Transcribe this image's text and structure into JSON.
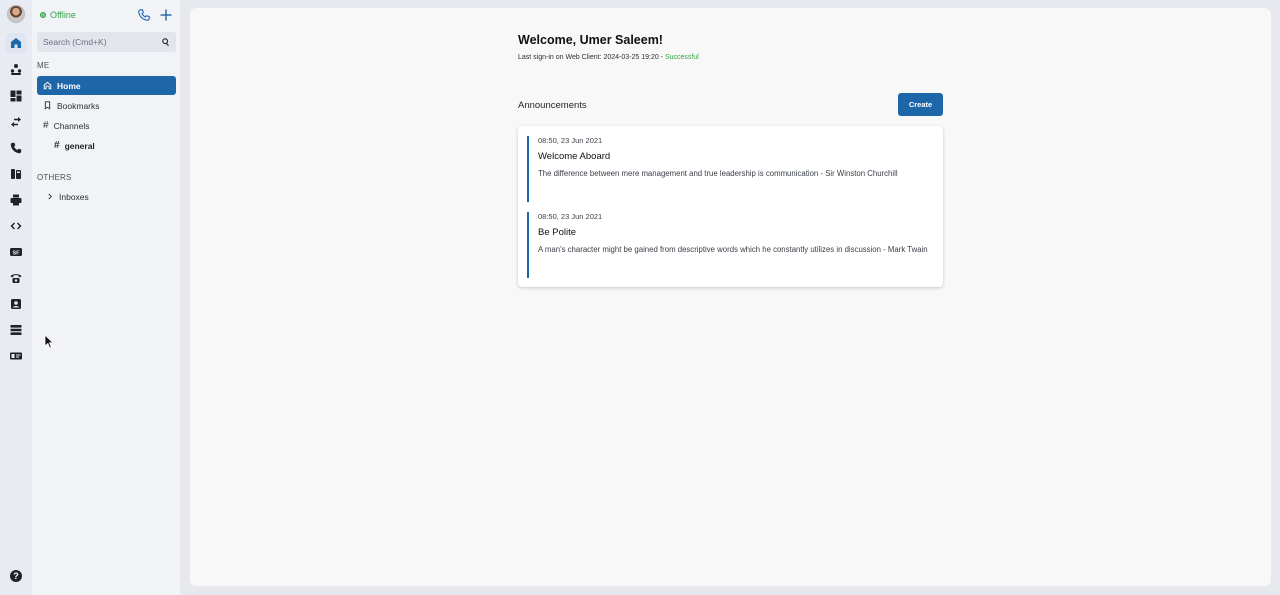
{
  "rail": {
    "icons": [
      "home-icon",
      "people-icon",
      "dashboard-icon",
      "transfer-icon",
      "phone-icon",
      "fax-icon",
      "print-icon",
      "code-icon",
      "sf-icon",
      "telephone-icon",
      "contact-card-icon",
      "storage-icon",
      "id-card-icon"
    ],
    "sf_label": "SF",
    "help_label": "?"
  },
  "sidebar": {
    "status": "Offline",
    "search_placeholder": "Search (Cmd+K)",
    "me_label": "ME",
    "items": [
      {
        "label": "Home"
      },
      {
        "label": "Bookmarks"
      },
      {
        "label": "Channels"
      },
      {
        "label": "general"
      }
    ],
    "others_label": "OTHERS",
    "inboxes_label": "Inboxes"
  },
  "main": {
    "welcome": "Welcome, Umer Saleem!",
    "signin_prefix": "Last sign-in on Web Client: 2024-03-25 19:20 - ",
    "signin_status": "Successful",
    "announcements_title": "Announcements",
    "create_label": "Create",
    "announcements": [
      {
        "date": "08:50, 23 Jun 2021",
        "title": "Welcome Aboard",
        "body": "The difference between mere management and true leadership is communication - Sir Winston Churchill"
      },
      {
        "date": "08:50, 23 Jun 2021",
        "title": "Be Polite",
        "body": "A man's character might be gained from descriptive words which he constantly utilizes in discussion - Mark Twain"
      }
    ]
  },
  "colors": {
    "accent": "#1d66a8",
    "success": "#3aa34a"
  }
}
